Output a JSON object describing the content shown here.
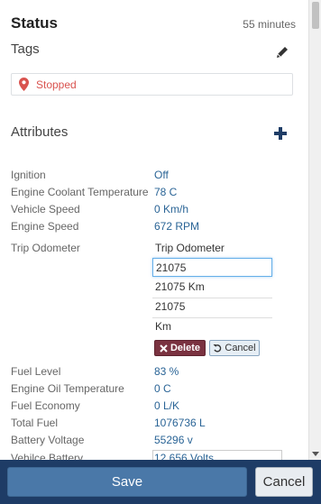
{
  "status": {
    "title": "Status",
    "time": "55 minutes"
  },
  "tags": {
    "title": "Tags",
    "items": [
      {
        "label": "Stopped",
        "color": "#d9534f"
      }
    ]
  },
  "attributes": {
    "title": "Attributes",
    "top_rows": [
      {
        "label": "Ignition",
        "value": "Off"
      },
      {
        "label": "Engine Coolant Temperature",
        "value": "78 C"
      },
      {
        "label": "Vehicle Speed",
        "value": "0 Km/h"
      },
      {
        "label": "Engine Speed",
        "value": "672 RPM"
      }
    ],
    "trip": {
      "label": "Trip Odometer",
      "name": "Trip Odometer",
      "input_value": "21075",
      "display_value": "21075 Km",
      "raw_value": "21075",
      "unit": "Km",
      "delete_label": "Delete",
      "cancel_label": "Cancel"
    },
    "bottom_rows": [
      {
        "label": "Fuel Level",
        "value": "83 %"
      },
      {
        "label": "Engine Oil Temperature",
        "value": "0 C"
      },
      {
        "label": "Fuel Economy",
        "value": "0 L/K"
      },
      {
        "label": "Total Fuel",
        "value": "1076736 L"
      },
      {
        "label": "Battery Voltage",
        "value": "55296 v"
      },
      {
        "label": "Vehilce Battery",
        "value": "12.656 Volts"
      }
    ]
  },
  "footer": {
    "save_label": "Save",
    "cancel_label": "Cancel"
  },
  "colors": {
    "accent": "#2a6496",
    "danger": "#d9534f",
    "footer_bg": "#1e3c66",
    "save_bg": "#4a78a8",
    "delete_bg": "#7a3240"
  }
}
